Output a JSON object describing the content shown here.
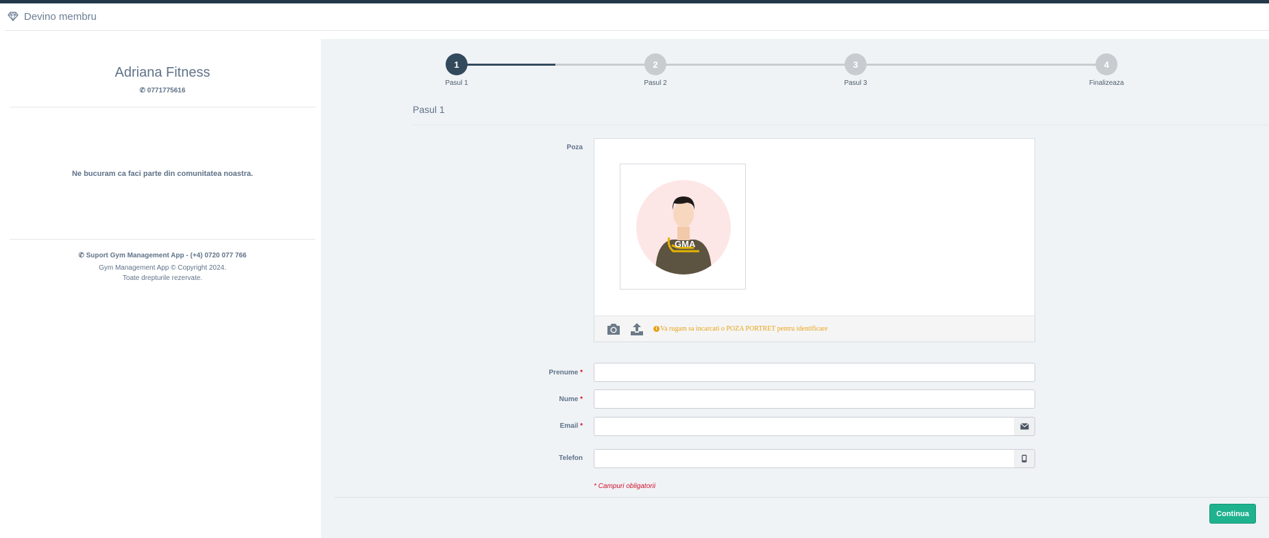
{
  "header": {
    "title": "Devino membru",
    "icon": "diamond-icon"
  },
  "sidebar": {
    "club_name": "Adriana Fitness",
    "club_phone": "0771775616",
    "welcome": "Ne bucuram ca faci parte din comunitatea noastra.",
    "support": "Suport Gym Management App - (+4) 0720 077 766",
    "copyright_line1": "Gym Management App © Copyright 2024.",
    "copyright_line2": "Toate drepturile rezervate."
  },
  "stepper": {
    "steps": [
      {
        "number": "1",
        "label": "Pasul 1",
        "active": true
      },
      {
        "number": "2",
        "label": "Pasul 2",
        "active": false
      },
      {
        "number": "3",
        "label": "Pasul 3",
        "active": false
      },
      {
        "number": "4",
        "label": "Finalizeaza",
        "active": false
      }
    ],
    "active_color": "#33495c",
    "inactive_color": "#c8ccd0"
  },
  "form": {
    "heading": "Pasul 1",
    "photo": {
      "label": "Poza",
      "hint": "Va rugam sa incarcati o POZA PORTRET pentru identificare",
      "avatar_logo": "GMA"
    },
    "fields": {
      "prenume": {
        "label": "Prenume",
        "required_mark": "*",
        "value": ""
      },
      "nume": {
        "label": "Nume",
        "required_mark": "*",
        "value": ""
      },
      "email": {
        "label": "Email",
        "required_mark": "*",
        "value": ""
      },
      "telefon": {
        "label": "Telefon",
        "value": ""
      }
    },
    "required_note": "* Campuri obligatorii",
    "continue_label": "Continua"
  },
  "colors": {
    "accent": "#1fb28e",
    "required": "#d0112b",
    "hint": "#e8a317",
    "topbar": "#243847"
  }
}
